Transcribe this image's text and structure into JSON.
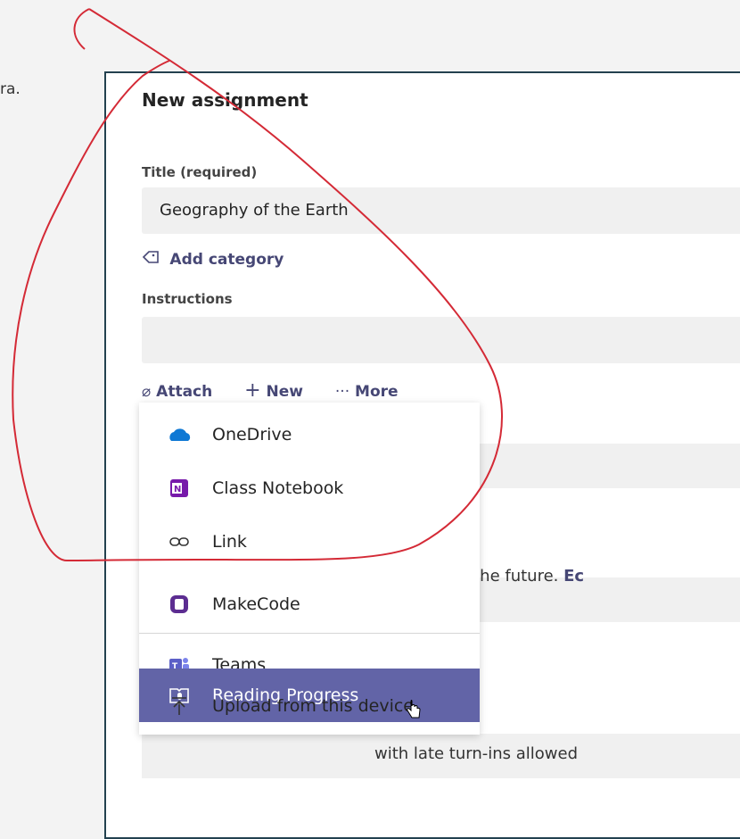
{
  "background_text": "ra.",
  "panel": {
    "heading": "New assignment",
    "title_label": "Title (required)",
    "title_value": "Geography of the Earth",
    "add_category": "Add category",
    "instructions_label": "Instructions",
    "toolbar": {
      "attach": "Attach",
      "new": "New",
      "more": "More"
    },
    "bg_text_1": "this class in the future.",
    "bg_text_1_link": "Ec",
    "bg_text_2": "with late turn-ins allowed"
  },
  "menu": {
    "items": [
      {
        "label": "OneDrive",
        "icon": "onedrive-icon"
      },
      {
        "label": "Class Notebook",
        "icon": "onenote-icon"
      },
      {
        "label": "Link",
        "icon": "link-icon"
      },
      {
        "label": "MakeCode",
        "icon": "makecode-icon"
      },
      {
        "label": "Teams",
        "icon": "teams-icon"
      },
      {
        "label": "Reading Progress",
        "icon": "reading-progress-icon",
        "selected": true
      },
      {
        "label": "Upload from this device",
        "icon": "upload-icon"
      }
    ]
  },
  "colors": {
    "accent": "#6264a7",
    "link": "#464775",
    "annotation": "#d42a36",
    "panel_border": "#23414f"
  }
}
